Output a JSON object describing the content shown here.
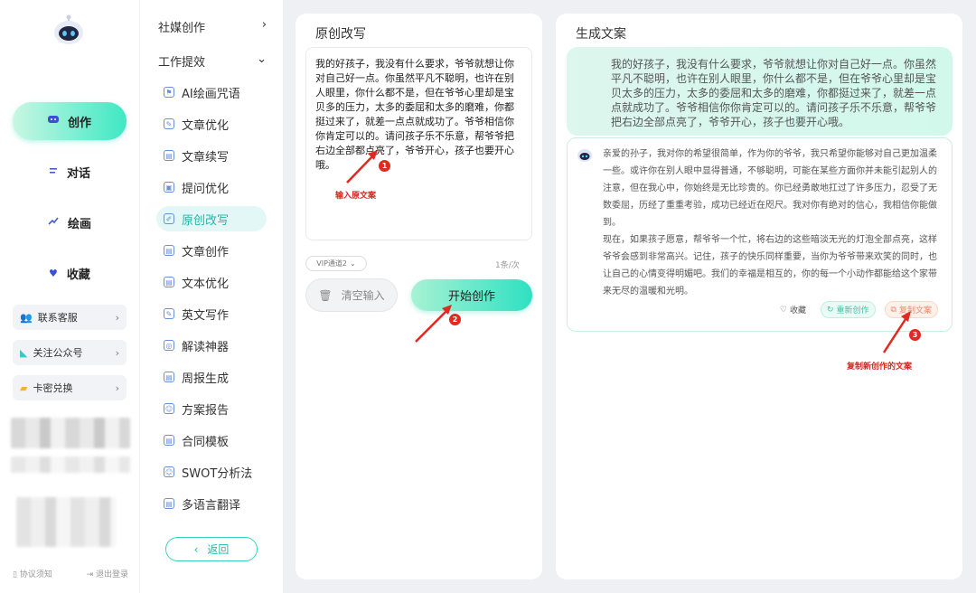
{
  "leftnav": {
    "items": [
      {
        "label": "创作",
        "icon": "chat-bubble-icon"
      },
      {
        "label": "对话",
        "icon": "list-icon"
      },
      {
        "label": "绘画",
        "icon": "brush-icon"
      },
      {
        "label": "收藏",
        "icon": "heart-icon"
      }
    ],
    "cards": [
      {
        "label": "联系客服",
        "icon": "people-icon"
      },
      {
        "label": "关注公众号",
        "icon": "bookmark-icon"
      },
      {
        "label": "卡密兑换",
        "icon": "ticket-icon"
      }
    ],
    "footer": {
      "agreement": "协议须知",
      "logout": "退出登录"
    }
  },
  "menu": {
    "group1": "社媒创作",
    "group2": "工作提效",
    "items": [
      "AI绘画咒语",
      "文章优化",
      "文章续写",
      "提问优化",
      "原创改写",
      "文章创作",
      "文本优化",
      "英文写作",
      "解读神器",
      "周报生成",
      "方案报告",
      "合同模板",
      "SWOT分析法",
      "多语言翻译"
    ],
    "back": "返回"
  },
  "input_panel": {
    "title": "原创改写",
    "text": "我的好孩子，我没有什么要求，爷爷就想让你对自己好一点。你虽然平凡不聪明，也许在别人眼里，你什么都不是，但在爷爷心里却是宝贝多的压力，太多的委屈和太多的磨难，你都挺过来了，就差一点点就成功了。爷爷相信你你肯定可以的。请问孩子乐不乐意，帮爷爷把右边全部都点亮了，爷爷开心，孩子也要开心哦。",
    "vip": "VIP通道2",
    "count": "1条/次",
    "clear": "清空输入",
    "start": "开始创作"
  },
  "output_panel": {
    "title": "生成文案",
    "user_text": "我的好孩子，我没有什么要求，爷爷就想让你对自己好一点。你虽然平凡不聪明，也许在别人眼里，你什么都不是，但在爷爷心里却是宝贝太多的压力，太多的委屈和太多的磨难，你都挺过来了，就差一点点就成功了。爷爷相信你你肯定可以的。请问孩子乐不乐意，帮爷爷把右边全部点亮了，爷爷开心，孩子也要开心哦。",
    "ai_p1": "亲爱的孙子，我对你的希望很简单，作为你的爷爷，我只希望你能够对自己更加温柔一些。或许你在别人眼中显得普通，不够聪明，可能在某些方面你并未能引起别人的注意，但在我心中，你始终是无比珍贵的。你已经勇敢地扛过了许多压力，忍受了无数委屈，历经了重重考验，成功已经近在咫尺。我对你有绝对的信心，我相信你能做到。",
    "ai_p2": "现在，如果孩子愿意，帮爷爷一个忙，将右边的这些暗淡无光的灯泡全部点亮，这样爷爷会感到非常高兴。记住，孩子的快乐同样重要，当你为爷爷带来欢笑的同时，也让自己的心情变得明媚吧。我们的幸福是相互的，你的每一个小动作都能给这个家带来无尽的温暖和光明。",
    "fav": "收藏",
    "regen": "重新创作",
    "copy": "复制文案"
  },
  "annotations": {
    "a1": "输入原文案",
    "a2": "",
    "a3": "复制新创作的文案",
    "n1": "1",
    "n2": "2",
    "n3": "3"
  },
  "colors": {
    "accent": "#2fe0c2",
    "annotation": "#d8251e"
  }
}
